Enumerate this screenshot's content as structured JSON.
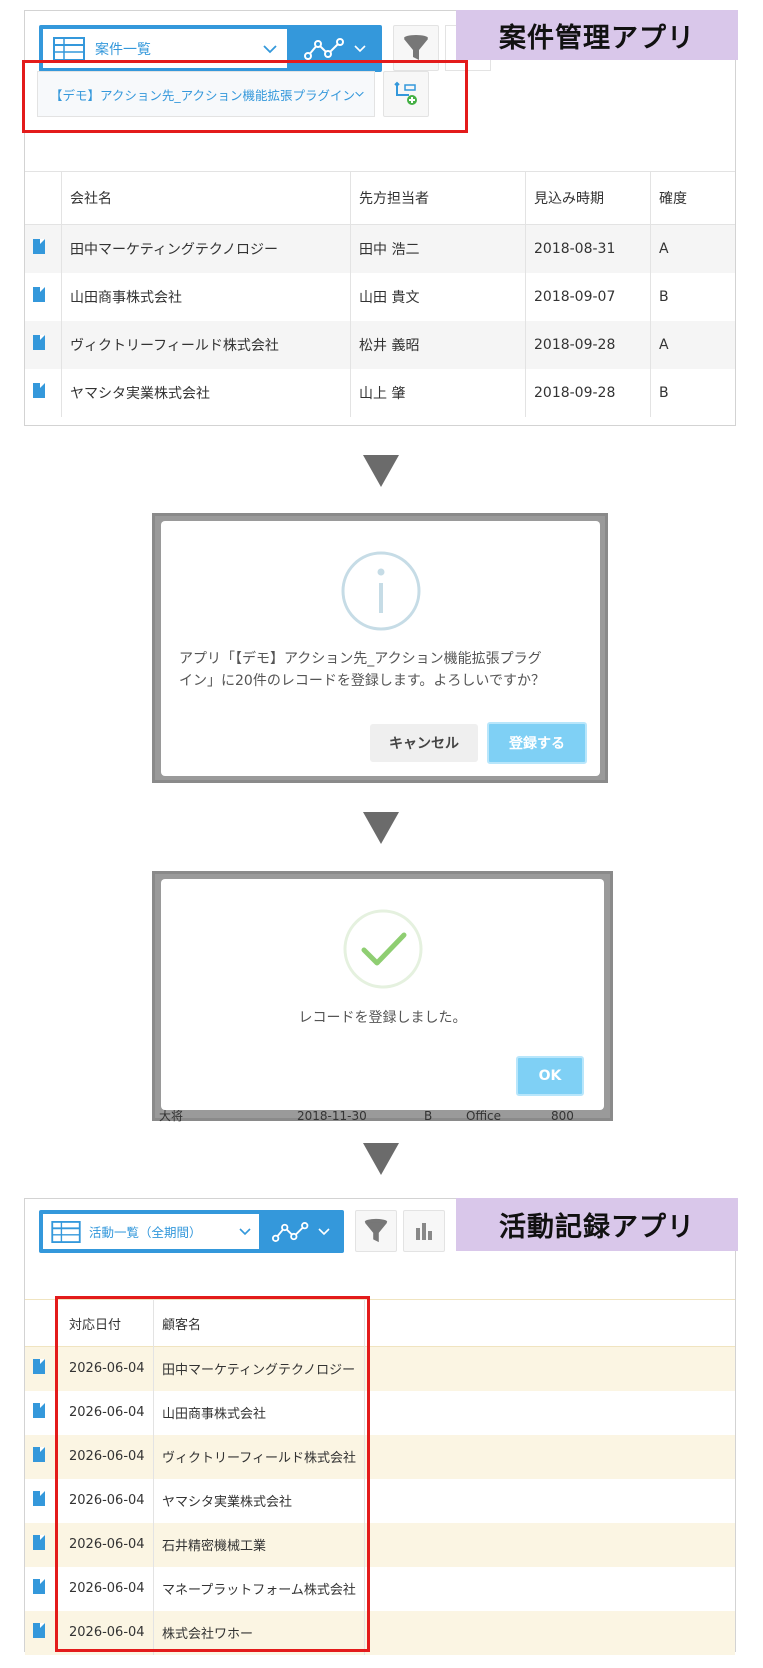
{
  "top": {
    "app_label": "案件管理アプリ",
    "view_select_label": "案件一覧",
    "plugin_select_label": "【デモ】アクション先_アクション機能拡張プラグイン",
    "columns": [
      "会社名",
      "先方担当者",
      "見込み時期",
      "確度"
    ],
    "rows": [
      {
        "company": "田中マーケティングテクノロジー",
        "contact": "田中 浩二",
        "date": "2018-08-31",
        "rank": "A"
      },
      {
        "company": "山田商事株式会社",
        "contact": "山田 貴文",
        "date": "2018-09-07",
        "rank": "B"
      },
      {
        "company": "ヴィクトリーフィールド株式会社",
        "contact": "松井 義昭",
        "date": "2018-09-28",
        "rank": "A"
      },
      {
        "company": "ヤマシタ実業株式会社",
        "contact": "山上 肇",
        "date": "2018-09-28",
        "rank": "B"
      }
    ]
  },
  "confirm_dialog": {
    "message_line1": "アプリ「【デモ】アクション先_アクション機能拡張プラグ",
    "message_line2": "イン」に20件のレコードを登録します。よろしいですか？",
    "cancel_label": "キャンセル",
    "submit_label": "登録する"
  },
  "done_dialog": {
    "message": "レコードを登録しました。",
    "ok_label": "OK",
    "bg_row": {
      "name": "大将",
      "date": "2018-11-30",
      "rank": "B",
      "product": "Office",
      "qty": "800"
    }
  },
  "bottom": {
    "app_label": "活動記録アプリ",
    "view_select_label": "活動一覧（全期間）",
    "columns": [
      "対応日付",
      "顧客名"
    ],
    "rows": [
      {
        "date": "2026-06-04",
        "customer": "田中マーケティングテクノロジー"
      },
      {
        "date": "2026-06-04",
        "customer": "山田商事株式会社"
      },
      {
        "date": "2026-06-04",
        "customer": "ヴィクトリーフィールド株式会社"
      },
      {
        "date": "2026-06-04",
        "customer": "ヤマシタ実業株式会社"
      },
      {
        "date": "2026-06-04",
        "customer": "石井精密機械工業"
      },
      {
        "date": "2026-06-04",
        "customer": "マネープラットフォーム株式会社"
      },
      {
        "date": "2026-06-04",
        "customer": "株式会社ワホー"
      }
    ]
  },
  "colors": {
    "accent_blue": "#3498db",
    "label_purple": "#d9c7ea",
    "highlight_red": "#e31b1b",
    "row_cream": "#fbf5e3"
  }
}
